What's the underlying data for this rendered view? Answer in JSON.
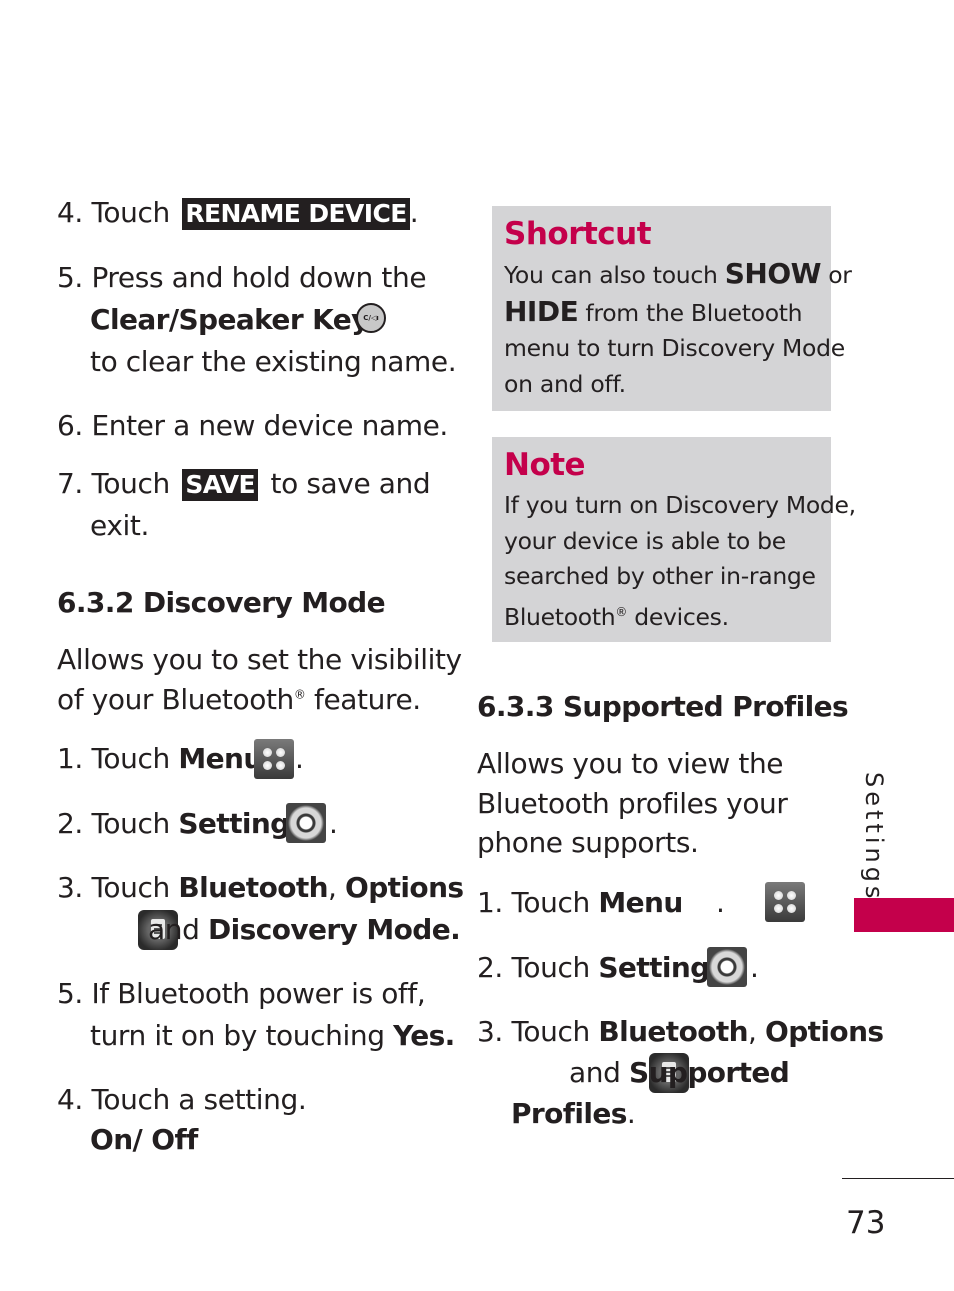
{
  "left_column": {
    "step4": {
      "num": "4.",
      "text": "Touch",
      "button": "RENAME DEVICE",
      "end": "."
    },
    "step5": {
      "num": "5.",
      "line1": "Press and hold down the",
      "key_label": "Clear/Speaker Key",
      "key_icon_text": "C/◁ı",
      "line3": "to clear the existing name."
    },
    "step6": {
      "num": "6.",
      "text": "Enter a new device name."
    },
    "step7": {
      "num": "7.",
      "text": "Touch",
      "button": "SAVE",
      "after": "to save and",
      "line2": "exit."
    },
    "section_heading": "6.3.2 Discovery Mode",
    "intro_line1": "Allows you to set the visibility",
    "intro_line2a": "of your Bluetooth",
    "intro_reg": "®",
    "intro_line2b": " feature.",
    "s1": {
      "num": "1.",
      "text": "Touch",
      "bold": "Menu",
      "end": "."
    },
    "s2": {
      "num": "2.",
      "text": "Touch",
      "bold": "Settings",
      "end": "."
    },
    "s3": {
      "num": "3.",
      "text": "Touch",
      "bold1": "Bluetooth",
      "comma": ",",
      "bold2": "Options",
      "and": "and",
      "bold3": "Discovery Mode."
    },
    "s5": {
      "num": "5.",
      "line1": "If Bluetooth power is off,",
      "line2": "turn it on by touching",
      "bold": "Yes."
    },
    "s4": {
      "num": "4.",
      "text": "Touch a setting.",
      "bold": "On/ Off"
    }
  },
  "shortcut_box": {
    "title": "Shortcut",
    "l1a": "You can also touch ",
    "l1b": "SHOW",
    "l1c": " or",
    "l2a": "HIDE",
    "l2b": " from the Bluetooth",
    "l3": "menu to turn Discovery Mode",
    "l4": "on and off."
  },
  "note_box": {
    "title": "Note",
    "l1": "If you turn on Discovery Mode,",
    "l2": "your device is able to be",
    "l3": "searched by other in-range",
    "l4a": "Bluetooth",
    "l4reg": "®",
    "l4b": " devices."
  },
  "right_column": {
    "section_heading": "6.3.3 Supported Profiles",
    "intro_line1": "Allows you to view the",
    "intro_line2": "Bluetooth profiles your",
    "intro_line3": "phone supports.",
    "s1": {
      "num": "1.",
      "text": "Touch",
      "bold": "Menu",
      "end": "."
    },
    "s2": {
      "num": "2.",
      "text": "Touch",
      "bold": "Settings",
      "end": "."
    },
    "s3": {
      "num": "3.",
      "text": "Touch",
      "bold1": "Bluetooth",
      "comma": ",",
      "bold2": "Options",
      "and": "and",
      "bold3": "Supported",
      "bold4": "Profiles",
      "end": "."
    }
  },
  "side_tab": {
    "label": "Settings",
    "color": "#c4004b"
  },
  "page_number": "73",
  "colors": {
    "accent": "#c4004b",
    "box_bg": "#d4d4d6",
    "text": "#231f20"
  }
}
